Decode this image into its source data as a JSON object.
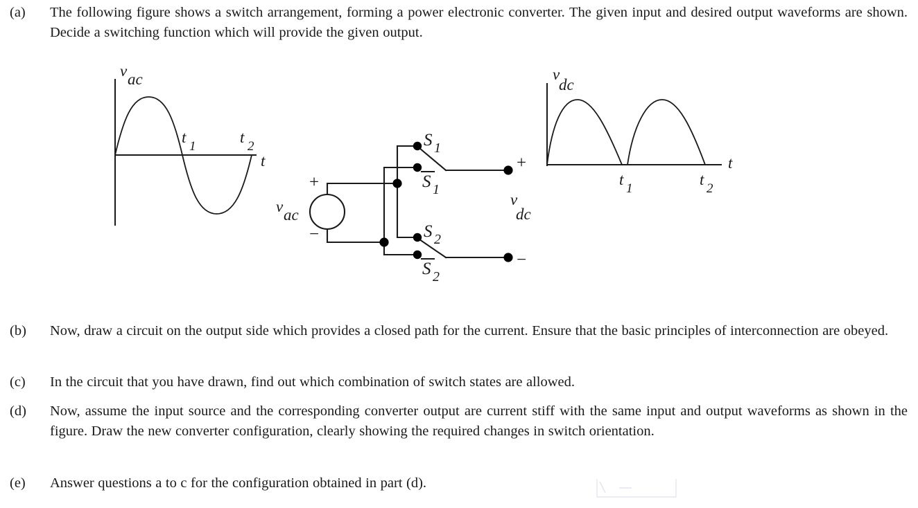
{
  "document": {
    "type": "textbook-problem",
    "ink_color": "#1a1a1a",
    "background": "#ffffff"
  },
  "questions": [
    {
      "id": "a",
      "label": "(a)",
      "text": "The following figure shows a switch arrangement, forming a power electronic converter. The given input and desired output waveforms are shown. Decide a switching function which will provide the given output."
    },
    {
      "id": "b",
      "label": "(b)",
      "text": "Now, draw a circuit on the output side which provides a closed path for the current. Ensure that the basic principles of interconnection are obeyed."
    },
    {
      "id": "c",
      "label": "(c)",
      "text": "In the circuit that you have drawn, find out which combination of switch states are allowed."
    },
    {
      "id": "d",
      "label": "(d)",
      "text": "Now, assume the input source and the corresponding converter output are current stiff with the same input and output waveforms as shown in the figure. Draw the new converter configuration, clearly showing the required changes in switch orientation."
    },
    {
      "id": "e",
      "label": "(e)",
      "text": "Answer questions a to c for the configuration obtained in part (d)."
    }
  ],
  "figure": {
    "input_plot": {
      "y_axis_label_main": "v",
      "y_axis_label_sub": "ac",
      "x_axis_label": "t",
      "tick_labels": [
        {
          "main": "t",
          "sub": "1"
        },
        {
          "main": "t",
          "sub": "2"
        }
      ],
      "waveform": "sine"
    },
    "circuit": {
      "source_label_main": "v",
      "source_label_sub": "ac",
      "source_plus": "+",
      "source_minus": "−",
      "switches": [
        {
          "name": "S1",
          "main": "S",
          "sub": "1",
          "bar": false
        },
        {
          "name": "S1bar",
          "main": "S",
          "sub": "1",
          "bar": true
        },
        {
          "name": "S2",
          "main": "S",
          "sub": "2",
          "bar": false
        },
        {
          "name": "S2bar",
          "main": "S",
          "sub": "2",
          "bar": true
        }
      ],
      "output_label_main": "v",
      "output_label_sub": "dc",
      "output_plus": "+",
      "output_minus": "−"
    },
    "output_plot": {
      "y_axis_label_main": "v",
      "y_axis_label_sub": "dc",
      "x_axis_label": "t",
      "tick_labels": [
        {
          "main": "t",
          "sub": "1"
        },
        {
          "main": "t",
          "sub": "2"
        }
      ],
      "waveform": "full-wave-rectified-sine"
    }
  },
  "chart_data": [
    {
      "type": "line",
      "name": "input-waveform",
      "title": "",
      "ylabel": "v_ac",
      "xlabel": "t",
      "xticks": [
        "t_1",
        "t_2"
      ],
      "xtick_values": [
        1,
        2
      ],
      "yticks": [],
      "xlim": [
        0,
        2.2
      ],
      "ylim": [
        -1.15,
        1.25
      ],
      "grid": false,
      "legend": false,
      "series": [
        {
          "name": "v_ac",
          "expression": "sin(pi*x)",
          "x": [
            0,
            0.1,
            0.2,
            0.3,
            0.4,
            0.5,
            0.6,
            0.7,
            0.8,
            0.9,
            1.0,
            1.1,
            1.2,
            1.3,
            1.4,
            1.5,
            1.6,
            1.7,
            1.8,
            1.9,
            2.0
          ],
          "values": [
            0,
            0.309,
            0.588,
            0.809,
            0.951,
            1.0,
            0.951,
            0.809,
            0.588,
            0.309,
            0,
            -0.309,
            -0.588,
            -0.809,
            -0.951,
            -1.0,
            -0.951,
            -0.809,
            -0.588,
            -0.309,
            0
          ]
        }
      ]
    },
    {
      "type": "line",
      "name": "output-waveform",
      "title": "",
      "ylabel": "v_dc",
      "xlabel": "t",
      "xticks": [
        "t_1",
        "t_2"
      ],
      "xtick_values": [
        1,
        2
      ],
      "yticks": [],
      "xlim": [
        0,
        2.3
      ],
      "ylim": [
        0,
        1.25
      ],
      "grid": false,
      "legend": false,
      "series": [
        {
          "name": "v_dc",
          "expression": "|sin(pi*x)|",
          "x": [
            0,
            0.1,
            0.2,
            0.3,
            0.4,
            0.5,
            0.6,
            0.7,
            0.8,
            0.9,
            1.0,
            1.1,
            1.2,
            1.3,
            1.4,
            1.5,
            1.6,
            1.7,
            1.8,
            1.9,
            2.0
          ],
          "values": [
            0,
            0.309,
            0.588,
            0.809,
            0.951,
            1.0,
            0.951,
            0.809,
            0.588,
            0.309,
            0,
            0.309,
            0.588,
            0.809,
            0.951,
            1.0,
            0.951,
            0.809,
            0.588,
            0.309,
            0
          ]
        }
      ]
    }
  ]
}
